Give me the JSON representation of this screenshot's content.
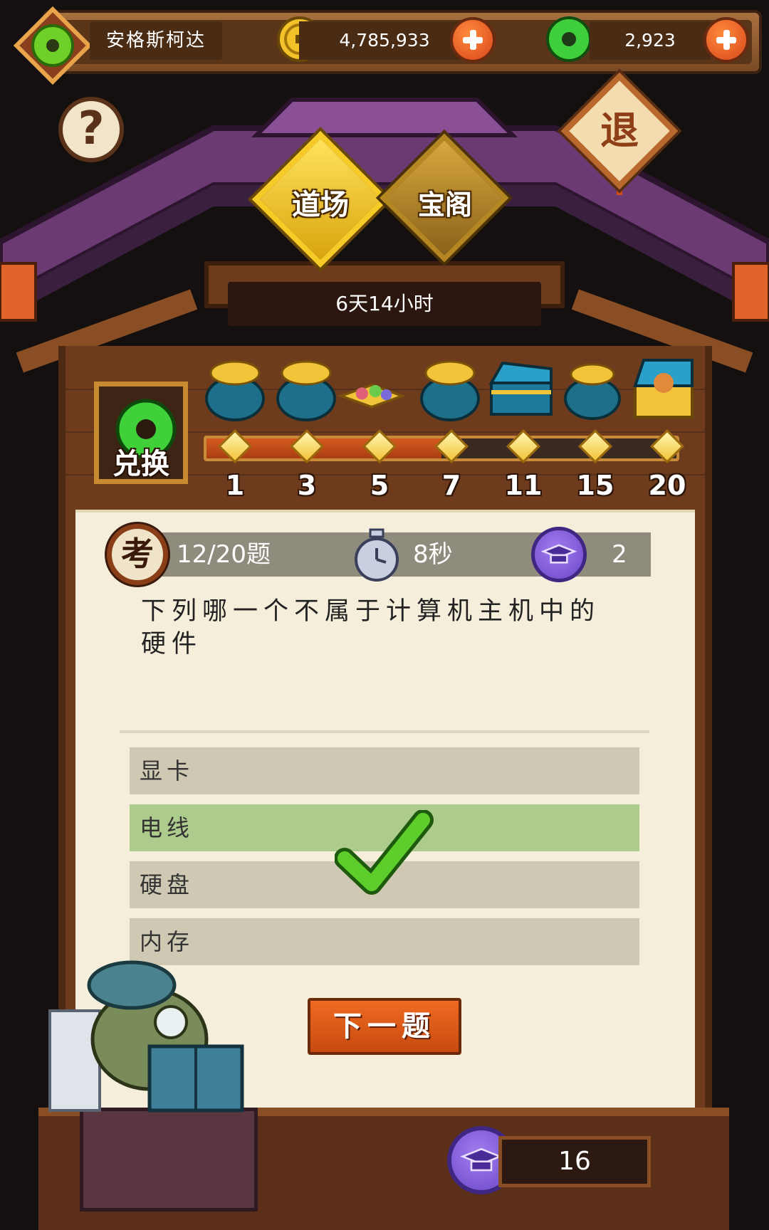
{
  "header": {
    "player_name": "安格斯柯达",
    "coins": "4,785,933",
    "jade": "2,923"
  },
  "nav": {
    "help": "?",
    "exit": "退",
    "tabs": [
      {
        "label": "道场",
        "active": true
      },
      {
        "label": "宝阁",
        "active": false
      }
    ]
  },
  "event": {
    "time_remaining": "6天14小时",
    "exchange_label": "兑换",
    "progress_fraction": 0.5,
    "milestones": [
      "1",
      "3",
      "5",
      "7",
      "11",
      "15",
      "20"
    ],
    "rewards": [
      "coin-bag",
      "coin-bag",
      "gem-tray",
      "coin-bag",
      "blue-chest",
      "coin-bag",
      "treasure-chest"
    ]
  },
  "quiz": {
    "exam_glyph": "考",
    "progress": "12/20题",
    "time_left": "8秒",
    "scholar_count": "2",
    "question": "下列哪一个不属于计算机主机中的硬件",
    "options": [
      {
        "label": "显卡",
        "state": "normal"
      },
      {
        "label": "电线",
        "state": "correct"
      },
      {
        "label": "硬盘",
        "state": "normal"
      },
      {
        "label": "内存",
        "state": "normal"
      }
    ],
    "next_label": "下一题"
  },
  "footer": {
    "total_scholar": "16"
  },
  "colors": {
    "wood": "#6e3b1c",
    "paper": "#f5eedb",
    "correct": "#aecb8e",
    "option": "#cfc8b3",
    "accent_orange": "#e0581a",
    "roof_purple": "#6b3a72"
  }
}
